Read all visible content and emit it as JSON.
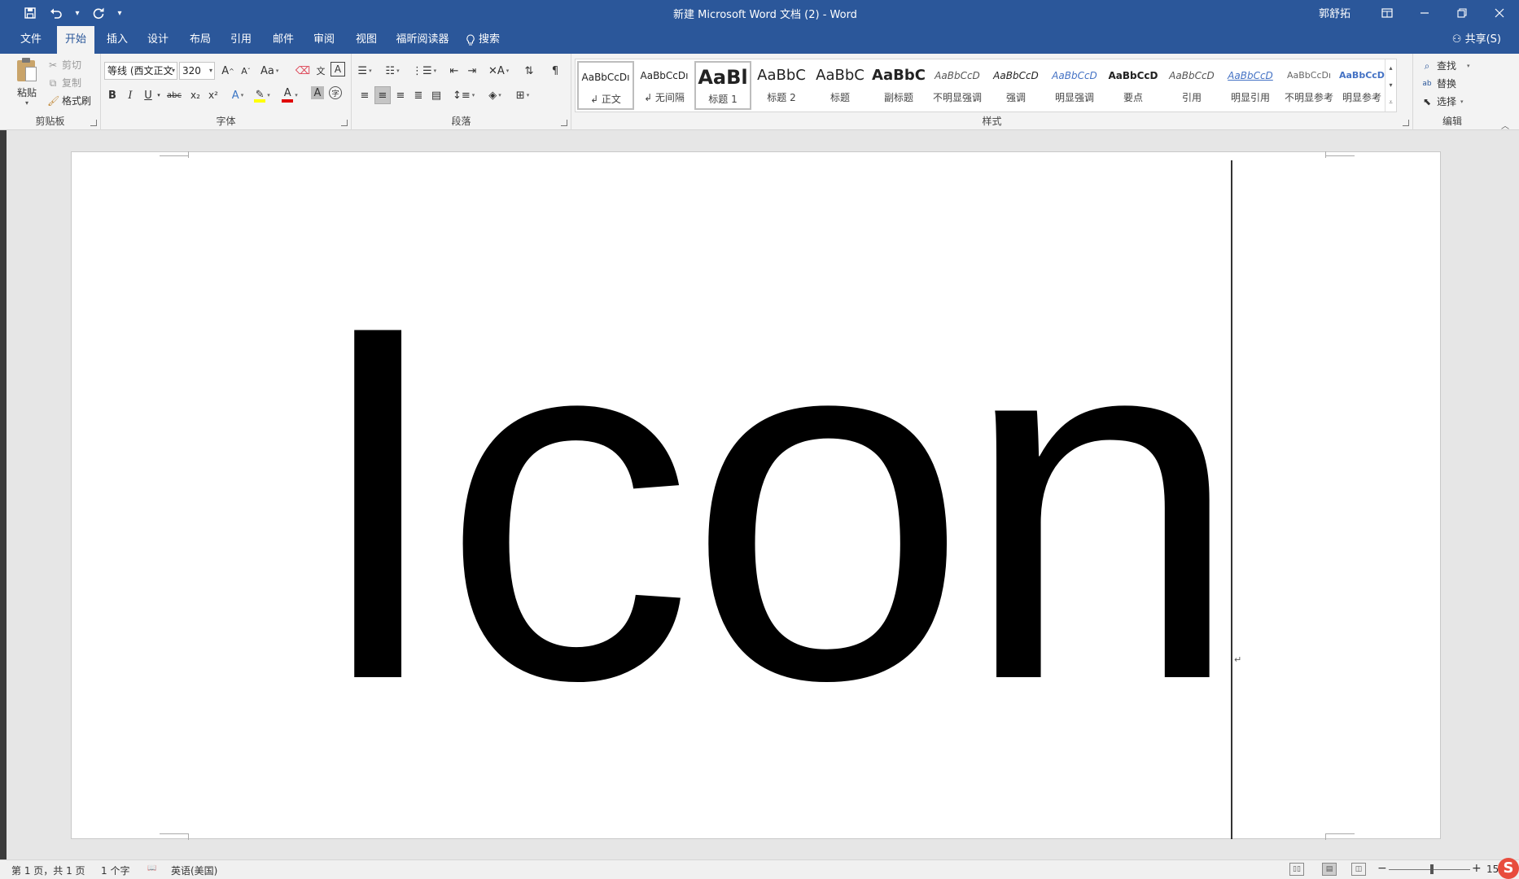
{
  "titlebar": {
    "title": "新建 Microsoft Word 文档 (2)  -  Word",
    "user": "郭舒拓",
    "qat": {
      "save_icon": "save-icon",
      "undo_icon": "undo-icon",
      "redo_icon": "redo-icon",
      "customize_icon": "customize-icon"
    },
    "controls": [
      "ribbon-display-icon",
      "minimize-icon",
      "restore-icon",
      "close-icon"
    ]
  },
  "tabs": [
    "文件",
    "开始",
    "插入",
    "设计",
    "布局",
    "引用",
    "邮件",
    "审阅",
    "视图",
    "福昕阅读器"
  ],
  "active_tab": "开始",
  "search_label": "搜索",
  "share_label": "共享(S)",
  "clipboard": {
    "label": "剪贴板",
    "paste": "粘贴",
    "cut": "剪切",
    "copy": "复制",
    "format_painter": "格式刷"
  },
  "font": {
    "label": "字体",
    "name": "等线 (西文正文",
    "size": "320",
    "change_case": "Aa",
    "bold": "B",
    "italic": "I",
    "underline": "U",
    "strikethrough": "abc",
    "subscript": "x₂",
    "superscript": "x²",
    "highlight_color": "#ffff00",
    "font_color": "#e00000"
  },
  "paragraph": {
    "label": "段落"
  },
  "styles": {
    "label": "样式",
    "items": [
      {
        "sample": "AaBbCcDı",
        "name": "↲ 正文"
      },
      {
        "sample": "AaBbCcDı",
        "name": "↲ 无间隔"
      },
      {
        "sample": "AaBl",
        "name": "标题 1"
      },
      {
        "sample": "AaBbC",
        "name": "标题 2"
      },
      {
        "sample": "AaBbC",
        "name": "标题"
      },
      {
        "sample": "AaBbC",
        "name": "副标题"
      },
      {
        "sample": "AaBbCcD",
        "name": "不明显强调"
      },
      {
        "sample": "AaBbCcD",
        "name": "强调"
      },
      {
        "sample": "AaBbCcD",
        "name": "明显强调"
      },
      {
        "sample": "AaBbCcD",
        "name": "要点"
      },
      {
        "sample": "AaBbCcD",
        "name": "引用"
      },
      {
        "sample": "AaBbCcD",
        "name": "明显引用"
      },
      {
        "sample": "AaBbCcDı",
        "name": "不明显参考"
      },
      {
        "sample": "AaBbCcDı",
        "name": "明显参考"
      }
    ]
  },
  "editing": {
    "label": "编辑",
    "find": "查找",
    "replace": "替换",
    "select": "选择"
  },
  "document": {
    "text": "Icon",
    "paragraph_mark": "↵"
  },
  "statusbar": {
    "page": "第 1 页，共 1 页",
    "words": "1 个字",
    "language": "英语(美国)",
    "zoom_minus": "−",
    "zoom_plus": "+",
    "zoom": "15"
  },
  "colors": {
    "accent": "#2b579a"
  }
}
